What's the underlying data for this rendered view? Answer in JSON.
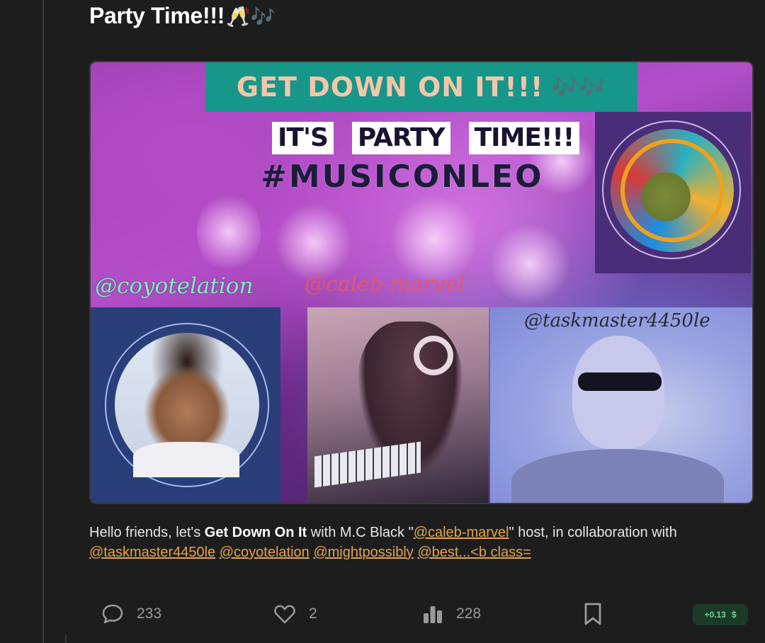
{
  "post": {
    "title": "Party Time!!!",
    "title_emoji": "🥂🎶"
  },
  "image": {
    "banner_text": "GET DOWN ON IT!!!",
    "banner_notes": "🎶🎶",
    "party_words": [
      "IT'S",
      "PARTY",
      "TIME!!!"
    ],
    "hashtag": "#MUSICONLEO",
    "handles": {
      "left": "@coyotelation",
      "middle": "@caleb-marvel",
      "right": "@taskmaster4450le"
    }
  },
  "body": {
    "intro": "Hello friends, let's ",
    "bold": "Get Down On It",
    "after_bold": " with M.C Black \"",
    "mention_host": "@caleb-marvel",
    "after_host": "\" host, in collaboration with",
    "mentions": [
      "@taskmaster4450le",
      "@coyotelation",
      "@mightpossibly"
    ],
    "trailing_link": "@best...<b class="
  },
  "actions": {
    "comments": "233",
    "likes": "2",
    "views": "228",
    "payout": "+0.13",
    "payout_icon": "$"
  },
  "colors": {
    "background": "#1d1d1e",
    "mention": "#e8a443",
    "payout_bg": "#1c3a28",
    "payout_text": "#6fd38f",
    "icon_gray": "#9a9a9c"
  },
  "icons": [
    "comment-icon",
    "heart-icon",
    "bar-chart-icon",
    "bookmark-icon",
    "dollar-icon"
  ]
}
